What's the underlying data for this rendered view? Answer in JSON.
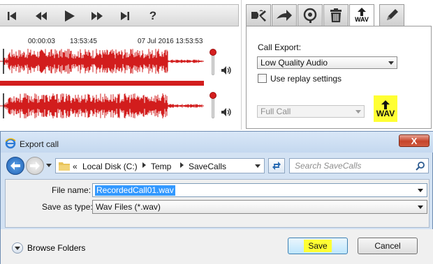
{
  "player": {
    "timeline": {
      "elapsed": "00:00:03",
      "clock": "13:53:45",
      "end_datetime": "07 Jul 2016 13:53:53"
    },
    "help_label": "?",
    "colors": {
      "waveform": "#d21d1d",
      "slider_knob": "#d41f1f"
    },
    "icons": [
      "skip-to-start-icon",
      "rewind-icon",
      "play-icon",
      "fast-forward-icon",
      "skip-to-end-icon",
      "help-icon",
      "volume-icon"
    ]
  },
  "tabs": [
    {
      "name": "settings",
      "icon": "wrench-icon"
    },
    {
      "name": "forward",
      "icon": "forward-arrow-icon"
    },
    {
      "name": "search",
      "icon": "magnify-icon"
    },
    {
      "name": "delete",
      "icon": "trash-icon"
    },
    {
      "name": "export",
      "icon": "wav-upload-icon",
      "label": "WAV",
      "active": true
    },
    {
      "name": "edit",
      "icon": "pencil-icon"
    }
  ],
  "export_panel": {
    "call_export_label": "Call Export:",
    "quality_value": "Low Quality Audio",
    "replay_checkbox_label": "Use replay settings",
    "replay_checked": false,
    "range_value": "Full Call",
    "wav_badge_label": "WAV",
    "highlight_color": "#ffff33"
  },
  "dialog": {
    "title": "Export call",
    "close_label": "X",
    "breadcrumb": {
      "overflow": "«",
      "items": [
        "Local Disk (C:)",
        "Temp",
        "SaveCalls"
      ]
    },
    "search_placeholder": "Search SaveCalls",
    "file_name_label": "File name:",
    "file_name_value": "RecordedCall01.wav",
    "save_type_label": "Save as type:",
    "save_type_value": "Wav Files (*.wav)",
    "browse_folders_label": "Browse Folders",
    "save_label": "Save",
    "cancel_label": "Cancel"
  }
}
